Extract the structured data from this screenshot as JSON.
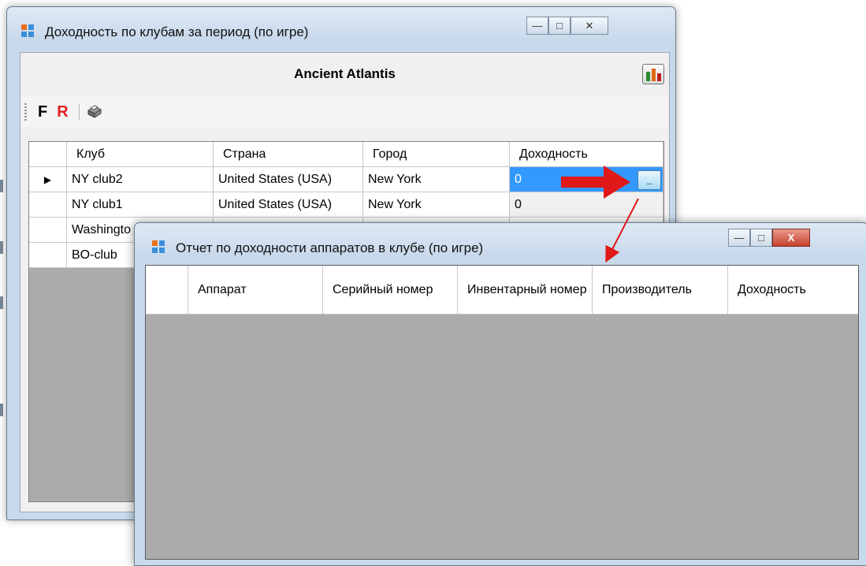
{
  "main_window": {
    "title": "Доходность по клубам за период (по игре)",
    "report_header": "Ancient Atlantis",
    "toolbar": {
      "filter_label": "F",
      "refresh_label": "R"
    },
    "grid": {
      "columns": [
        "Клуб",
        "Страна",
        "Город",
        "Доходность"
      ],
      "rows": [
        {
          "club": "NY club2",
          "country": "United States (USA)",
          "city": "New York",
          "income": "0"
        },
        {
          "club": "NY club1",
          "country": "United States (USA)",
          "city": "New York",
          "income": "0"
        },
        {
          "club": "Washingto",
          "country": "",
          "city": "",
          "income": ""
        },
        {
          "club": "BO-club",
          "country": "",
          "city": "",
          "income": ""
        }
      ],
      "ellipsis_label": ".."
    }
  },
  "detail_window": {
    "title": "Отчет по доходности аппаратов в клубе (по игре)",
    "grid": {
      "columns": [
        "Аппарат",
        "Серийный номер",
        "Инвентарный номер",
        "Производитель",
        "Доходность"
      ]
    }
  },
  "colors": {
    "selection": "#3399ff",
    "filter_F": "#000000",
    "refresh_R": "#e02020",
    "annotation_arrow": "#e01818",
    "grid_background": "#ababab"
  }
}
